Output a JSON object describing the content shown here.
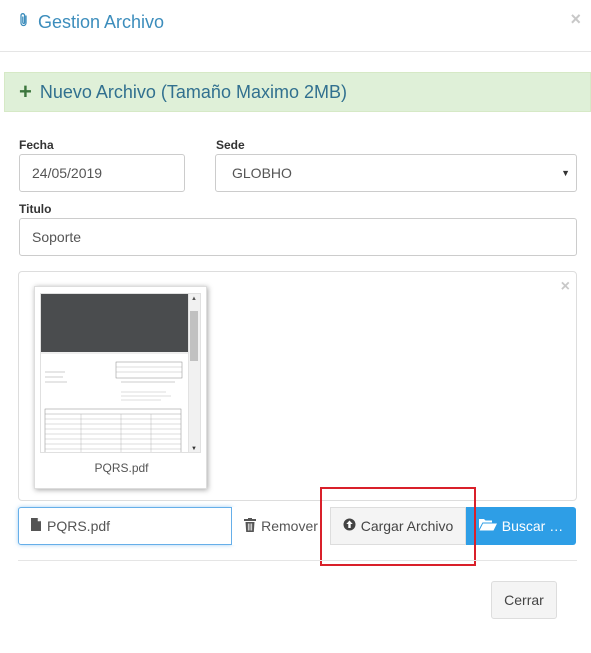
{
  "modal": {
    "title": "Gestion Archivo",
    "close_symbol": "×"
  },
  "alert": {
    "plus_symbol": "+",
    "text": "Nuevo Archivo (Tamaño Maximo 2MB)"
  },
  "form": {
    "fecha_label": "Fecha",
    "fecha_value": "24/05/2019",
    "sede_label": "Sede",
    "sede_value": "GLOBHO",
    "titulo_label": "Titulo",
    "titulo_value": "Soporte"
  },
  "preview": {
    "close_symbol": "×",
    "filename": "PQRS.pdf"
  },
  "file_input": {
    "filename": "PQRS.pdf",
    "remove_label": "Remover",
    "upload_label": "Cargar Archivo",
    "browse_label": "Buscar …"
  },
  "footer": {
    "close_label": "Cerrar"
  },
  "icons": {
    "title": "paperclip-icon",
    "file": "file-icon",
    "remove": "trash-icon",
    "upload": "circle-arrow-up-icon",
    "browse": "folder-open-icon"
  },
  "colors": {
    "title_blue": "#3c8dbc",
    "success_bg": "#dff0d8",
    "primary_button": "#2e9ee6",
    "highlight_red": "#d9202a"
  }
}
